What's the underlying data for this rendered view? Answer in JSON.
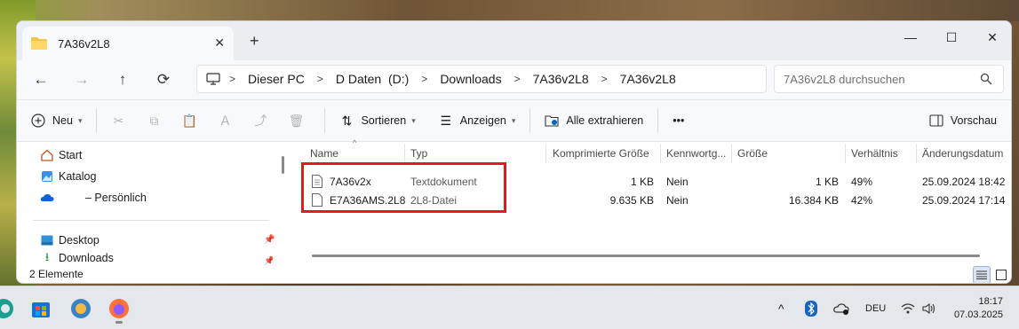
{
  "window": {
    "tab_title": "7A36v2L8",
    "new_tab": "+",
    "minimize": "—",
    "maximize": "☐",
    "close": "✕"
  },
  "nav": {
    "back": "←",
    "forward": "→",
    "up": "↑",
    "refresh": "⟳",
    "breadcrumbs": [
      "Dieser PC",
      "D Daten  (D:)",
      "Downloads",
      "7A36v2L8",
      "7A36v2L8"
    ],
    "search_placeholder": "7A36v2L8 durchsuchen"
  },
  "toolbar": {
    "new_label": "Neu",
    "sort_label": "Sortieren",
    "view_label": "Anzeigen",
    "extract_label": "Alle extrahieren",
    "more_label": "•••",
    "preview_label": "Vorschau"
  },
  "sidebar": {
    "items": [
      {
        "label": "Start",
        "icon": "home-icon"
      },
      {
        "label": "Katalog",
        "icon": "gallery-icon"
      },
      {
        "label": "– Persönlich",
        "icon": "onedrive-icon"
      },
      {
        "label": "Desktop",
        "icon": "desktop-icon"
      },
      {
        "label": "Downloads",
        "icon": "download-icon"
      }
    ]
  },
  "columns": {
    "name": "Name",
    "type": "Typ",
    "compressed": "Komprimierte Größe",
    "password": "Kennwortg...",
    "size": "Größe",
    "ratio": "Verhältnis",
    "modified": "Änderungsdatum"
  },
  "files": [
    {
      "name": "7A36v2x",
      "type": "Textdokument",
      "compressed": "1 KB",
      "password": "Nein",
      "size": "1 KB",
      "ratio": "49%",
      "modified": "25.09.2024 18:42"
    },
    {
      "name": "E7A36AMS.2L8",
      "type": "2L8-Datei",
      "compressed": "9.635 KB",
      "password": "Nein",
      "size": "16.384 KB",
      "ratio": "42%",
      "modified": "25.09.2024 17:14"
    }
  ],
  "status": {
    "count": "2 Elemente"
  },
  "taskbar": {
    "language": "DEU",
    "time": "18:17",
    "date": "07.03.2025"
  },
  "colors": {
    "accent": "#0067c0",
    "highlight": "#e01b24",
    "folder": "#f4c542"
  }
}
